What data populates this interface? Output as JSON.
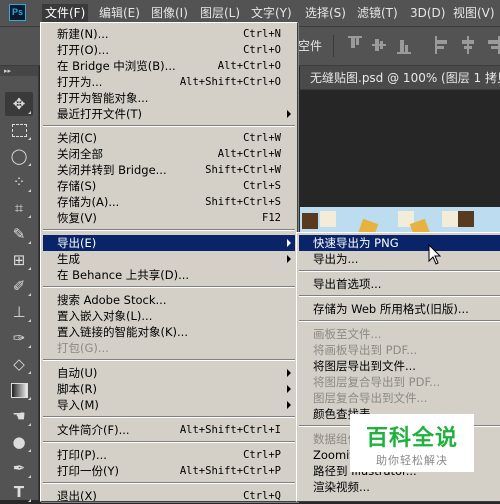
{
  "app": {
    "logo": "Ps"
  },
  "menubar": {
    "items": [
      "文件(F)",
      "编辑(E)",
      "图像(I)",
      "图层(L)",
      "文字(Y)",
      "选择(S)",
      "滤镜(T)",
      "3D(D)",
      "视图(V)"
    ]
  },
  "options_bar": {
    "partial_text": "空件"
  },
  "document_tab": {
    "title": "无缝贴图.psd @ 100% (图层 1 拷贝"
  },
  "toolbar": {
    "collapse_glyph": "▸▸",
    "tools": [
      "move-tool",
      "marquee-tool",
      "lasso-tool",
      "quick-selection-tool",
      "crop-tool",
      "eyedropper-tool",
      "healing-brush-tool",
      "brush-tool",
      "clone-stamp-tool",
      "history-brush-tool",
      "eraser-tool",
      "gradient-tool",
      "blur-tool",
      "dodge-tool",
      "pen-tool",
      "type-tool"
    ]
  },
  "file_menu": {
    "items": [
      {
        "label": "新建(N)...",
        "shortcut": "Ctrl+N"
      },
      {
        "label": "打开(O)...",
        "shortcut": "Ctrl+O"
      },
      {
        "label": "在 Bridge 中浏览(B)...",
        "shortcut": "Alt+Ctrl+O"
      },
      {
        "label": "打开为...",
        "shortcut": "Alt+Shift+Ctrl+O"
      },
      {
        "label": "打开为智能对象...",
        "shortcut": ""
      },
      {
        "label": "最近打开文件(T)",
        "shortcut": "",
        "submenu": true
      },
      {
        "label": "关闭(C)",
        "shortcut": "Ctrl+W"
      },
      {
        "label": "关闭全部",
        "shortcut": "Alt+Ctrl+W"
      },
      {
        "label": "关闭并转到 Bridge...",
        "shortcut": "Shift+Ctrl+W"
      },
      {
        "label": "存储(S)",
        "shortcut": "Ctrl+S"
      },
      {
        "label": "存储为(A)...",
        "shortcut": "Shift+Ctrl+S"
      },
      {
        "label": "恢复(V)",
        "shortcut": "F12"
      },
      {
        "label": "导出(E)",
        "shortcut": "",
        "submenu": true,
        "highlighted": true
      },
      {
        "label": "生成",
        "shortcut": "",
        "submenu": true
      },
      {
        "label": "在 Behance 上共享(D)...",
        "shortcut": ""
      },
      {
        "label": "搜索 Adobe Stock...",
        "shortcut": ""
      },
      {
        "label": "置入嵌入对象(L)...",
        "shortcut": ""
      },
      {
        "label": "置入链接的智能对象(K)...",
        "shortcut": ""
      },
      {
        "label": "打包(G)...",
        "shortcut": "",
        "disabled": true
      },
      {
        "label": "自动(U)",
        "shortcut": "",
        "submenu": true
      },
      {
        "label": "脚本(R)",
        "shortcut": "",
        "submenu": true
      },
      {
        "label": "导入(M)",
        "shortcut": "",
        "submenu": true
      },
      {
        "label": "文件简介(F)...",
        "shortcut": "Alt+Shift+Ctrl+I"
      },
      {
        "label": "打印(P)...",
        "shortcut": "Ctrl+P"
      },
      {
        "label": "打印一份(Y)",
        "shortcut": "Alt+Shift+Ctrl+P"
      },
      {
        "label": "退出(X)",
        "shortcut": "Ctrl+Q"
      }
    ]
  },
  "export_submenu": {
    "items": [
      {
        "label": "快速导出为 PNG",
        "highlighted": true
      },
      {
        "label": "导出为..."
      },
      {
        "label": "导出首选项..."
      },
      {
        "label": "存储为 Web 所用格式(旧版)..."
      },
      {
        "label": "画板至文件...",
        "disabled": true
      },
      {
        "label": "将画板导出到 PDF...",
        "disabled": true
      },
      {
        "label": "将图层导出到文件..."
      },
      {
        "label": "将图层复合导出到 PDF...",
        "disabled": true
      },
      {
        "label": "图层复合导出到文件...",
        "disabled": true
      },
      {
        "label": "颜色查找表..."
      },
      {
        "label": "数据组作为文件...",
        "disabled": true
      },
      {
        "label": "Zoomify..."
      },
      {
        "label": "路径到 Illustrator..."
      },
      {
        "label": "渲染视频..."
      }
    ]
  },
  "watermark": {
    "title": "百科全说",
    "subtitle": "助你轻松解决"
  },
  "colors": {
    "menu_bg": "#d4d0c8",
    "highlight": "#0a246a",
    "ui_dark": "#535353",
    "watermark_green": "#1eb23c"
  }
}
